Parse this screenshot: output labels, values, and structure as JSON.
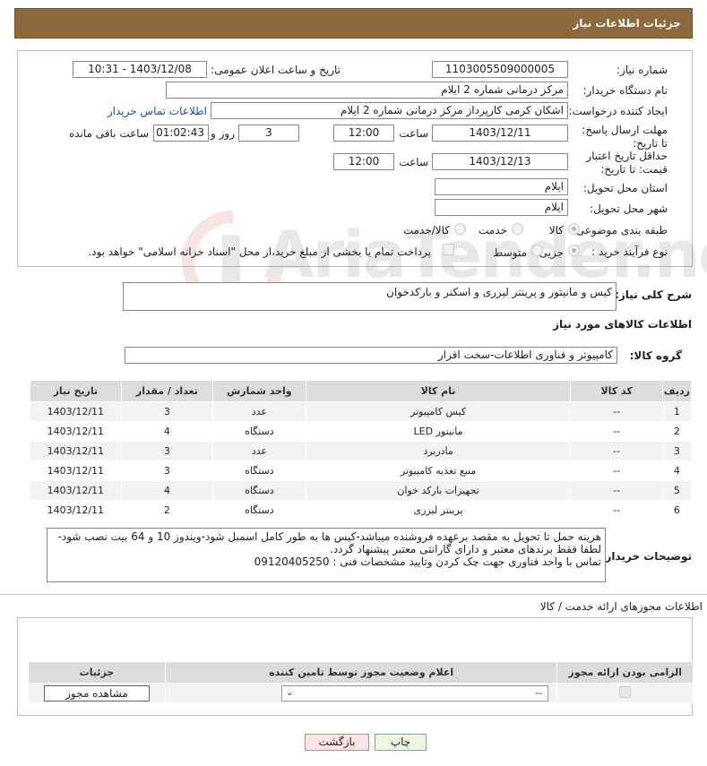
{
  "header": {
    "title": "جزئیات اطلاعات نیاز"
  },
  "watermark": {
    "text": "AriaTender.neT"
  },
  "form": {
    "need_number_label": "شماره نیاز:",
    "need_number_value": "1103005509000005",
    "announce_label": "تاریخ و ساعت اعلان عمومی:",
    "announce_value": "1403/12/08 - 10:31",
    "buyer_org_label": "نام دستگاه خریدار:",
    "buyer_org_value": "مرکز درمانی شماره 2 ایلام",
    "requester_label": "ایجاد کننده درخواست:",
    "requester_value": "اشکان کرمی کارپرداز مرکز درمانی شماره 2 ایلام",
    "buyer_contact_link": "اطلاعات تماس خریدار",
    "deadline_label": "مهلت ارسال پاسخ: تا تاریخ:",
    "deadline_date": "1403/12/11",
    "time_label": "ساعت",
    "deadline_time": "12:00",
    "days_value": "3",
    "days_label": "روز و",
    "remaining_time": "01:02:43",
    "remaining_label": "ساعت باقی مانده",
    "validity_label": "حداقل تاریخ اعتبار قیمت: تا تاریخ:",
    "validity_date": "1403/12/13",
    "validity_time": "12:00",
    "province_label": "استان محل تحویل:",
    "province_value": "ایلام",
    "city_label": "شهر محل تحویل:",
    "city_value": "ایلام",
    "category_label": "طبقه بندی موضوعی:",
    "category_options": [
      "کالا",
      "خدمت",
      "کالا/خدمت"
    ],
    "process_label": "نوع فرآیند خرید :",
    "process_options": [
      "جزیی",
      "متوسط"
    ],
    "payment_note": "پرداخت تمام یا بخشی از مبلغ خرید،از محل \"اسناد خزانه اسلامی\" خواهد بود."
  },
  "description": {
    "label": "شرح کلی نیاز:",
    "value": "کیس و مانیتور و پرینتر لیزری و اسکنر و بارکدخوان"
  },
  "goods": {
    "section_title": "اطلاعات کالاهای مورد نیاز",
    "group_label": "گروه کالا:",
    "group_value": "کامپیوتر و فناوری اطلاعات-سخت افزار",
    "columns": [
      "ردیف",
      "کد کالا",
      "نام کالا",
      "واحد شمارش",
      "تعداد / مقدار",
      "تاریخ نیاز"
    ],
    "rows": [
      [
        "1",
        "--",
        "کیس کامپیوتر",
        "عدد",
        "3",
        "1403/12/11"
      ],
      [
        "2",
        "--",
        "مانیتور LED",
        "دستگاه",
        "4",
        "1403/12/11"
      ],
      [
        "3",
        "--",
        "مادربرد",
        "عدد",
        "3",
        "1403/12/11"
      ],
      [
        "4",
        "--",
        "منبع تغذیه کامپیوتر",
        "دستگاه",
        "3",
        "1403/12/11"
      ],
      [
        "5",
        "--",
        "تجهیزات بارکد خوان",
        "دستگاه",
        "4",
        "1403/12/11"
      ],
      [
        "6",
        "--",
        "پرینتر لیزری",
        "دستگاه",
        "2",
        "1403/12/11"
      ]
    ]
  },
  "buyer_notes": {
    "label": "توضیحات خریدار:",
    "line1": "هزینه حمل تا تحویل به مقصد برعهده فروشنده میباشد-کیس ها به طور کامل اسمبل شود-ویندوز 10 و 64 بیت نصب شود-",
    "line2": "لطفا فقط برندهای معتبر و دارای گارانتی معتبر پیشنهاد گردد.",
    "line3": "تماس با واحد فناوری جهت چک کردن وتایید مشخصات فنی : 09120405250"
  },
  "permits": {
    "section_title": "اطلاعات مجوزهای ارائه خدمت / کالا",
    "columns": [
      "الزامی بودن ارائه مجوز",
      "اعلام وضعیت مجوز توسط تامین کننده",
      "جزئیات"
    ],
    "select_value": "--",
    "view_button": "مشاهده مجوز"
  },
  "actions": {
    "print": "چاپ",
    "back": "بازگشت"
  }
}
